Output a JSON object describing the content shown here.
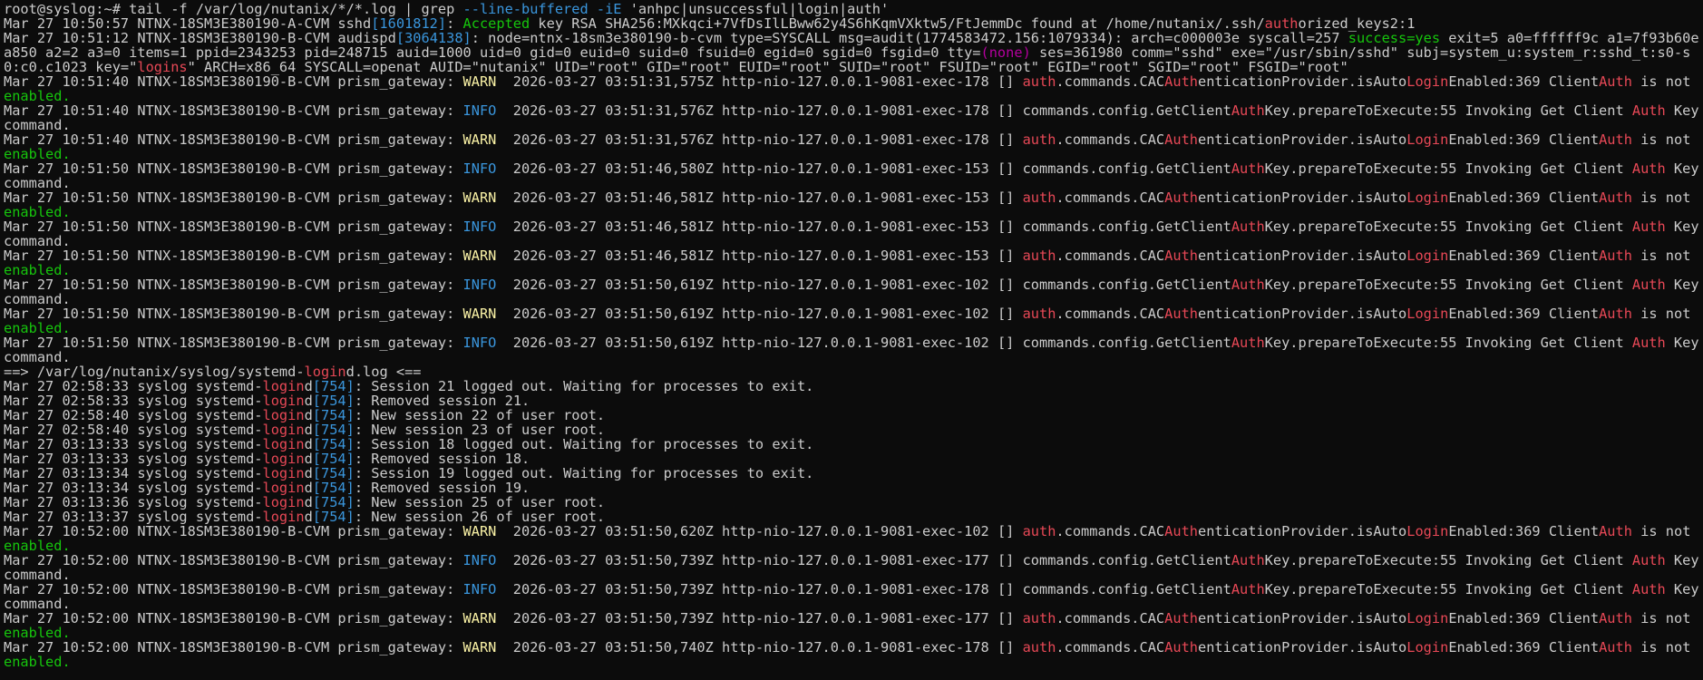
{
  "window": {
    "title": "root@syslog:~"
  },
  "colors": {
    "background": "#0c0c0c",
    "foreground": "#cccccc",
    "r": "#e74856",
    "g": "#16c60c",
    "b": "#3a96dd",
    "y": "#f9f1a5",
    "c": "#61d6d6",
    "m": "#b4009e"
  },
  "terminal": {
    "lines": [
      [
        {
          "t": "root@syslog:~# tail -f /var/log/nutanix/*/*.log | grep ",
          "c": "w"
        },
        {
          "t": "--line-buffered -iE",
          "c": "b"
        },
        {
          "t": " 'anhpc|unsuccessful|login|auth'",
          "c": "w"
        }
      ],
      [
        {
          "t": "Mar 27 10:50:57 NTNX-18SM3E380190-A-CVM sshd",
          "c": "w"
        },
        {
          "t": "[1601812]",
          "c": "b"
        },
        {
          "t": ": ",
          "c": "w"
        },
        {
          "t": "Accepted",
          "c": "g"
        },
        {
          "t": " key RSA SHA256:MXkqci+7VfDsIlLBww62y4S6hKqmVXktw5/FtJemmDc found at /home/nutanix/.ssh/",
          "c": "w"
        },
        {
          "t": "auth",
          "c": "r"
        },
        {
          "t": "orized_keys2:1",
          "c": "w"
        }
      ],
      [
        {
          "t": "Mar 27 10:51:12 NTNX-18SM3E380190-B-CVM audispd",
          "c": "w"
        },
        {
          "t": "[3064138]",
          "c": "b"
        },
        {
          "t": ": node=ntnx-18sm3e380190-b-cvm type=SYSCALL msg=audit(1774583472.156:1079334): arch=c000003e syscall=257 ",
          "c": "w"
        },
        {
          "t": "success=yes",
          "c": "g"
        },
        {
          "t": " exit=5 a0=ffffff9c a1=7f93b60ea850 a2=2 a3=0 items=1 ppid=2343253 pid=248715 auid=1000 uid=0 gid=0 euid=0 suid=0 fsuid=0 egid=0 sgid=0 fsgid=0 tty=",
          "c": "w"
        },
        {
          "t": "(none)",
          "c": "m"
        },
        {
          "t": " ses=361980 comm=\"sshd\" exe=\"/usr/sbin/sshd\" subj=system_u:system_r:sshd_t:s0-s0:c0.c1023 key=\"",
          "c": "w"
        },
        {
          "t": "logins",
          "c": "r"
        },
        {
          "t": "\" ARCH=x86_64 SYSCALL=openat AUID=\"nutanix\" UID=\"root\" GID=\"root\" EUID=\"root\" SUID=\"root\" FSUID=\"root\" EGID=\"root\" SGID=\"root\" FSGID=\"root\"",
          "c": "w"
        }
      ],
      [
        {
          "t": "Mar 27 10:51:40 NTNX-18SM3E380190-B-CVM prism_gateway: ",
          "c": "w"
        },
        {
          "t": "WARN",
          "c": "y"
        },
        {
          "t": "  2026-03-27 03:51:31,575Z http-nio-127.0.0.1-9081-exec-178 [] ",
          "c": "w"
        },
        {
          "t": "auth",
          "c": "r"
        },
        {
          "t": ".commands.CAC",
          "c": "w"
        },
        {
          "t": "Auth",
          "c": "r"
        },
        {
          "t": "enticationProvider.isAuto",
          "c": "w"
        },
        {
          "t": "Login",
          "c": "r"
        },
        {
          "t": "Enabled:369 Client",
          "c": "w"
        },
        {
          "t": "Auth",
          "c": "r"
        },
        {
          "t": " is not ",
          "c": "w"
        },
        {
          "t": "enabled.",
          "c": "g"
        }
      ],
      [
        {
          "t": "Mar 27 10:51:40 NTNX-18SM3E380190-B-CVM prism_gateway: ",
          "c": "w"
        },
        {
          "t": "INFO",
          "c": "b"
        },
        {
          "t": "  2026-03-27 03:51:31,576Z http-nio-127.0.0.1-9081-exec-178 [] commands.config.GetClient",
          "c": "w"
        },
        {
          "t": "Auth",
          "c": "r"
        },
        {
          "t": "Key.prepareToExecute:55 Invoking Get Client ",
          "c": "w"
        },
        {
          "t": "Auth",
          "c": "r"
        },
        {
          "t": " Key command.",
          "c": "w"
        }
      ],
      [
        {
          "t": "Mar 27 10:51:40 NTNX-18SM3E380190-B-CVM prism_gateway: ",
          "c": "w"
        },
        {
          "t": "WARN",
          "c": "y"
        },
        {
          "t": "  2026-03-27 03:51:31,576Z http-nio-127.0.0.1-9081-exec-178 [] ",
          "c": "w"
        },
        {
          "t": "auth",
          "c": "r"
        },
        {
          "t": ".commands.CAC",
          "c": "w"
        },
        {
          "t": "Auth",
          "c": "r"
        },
        {
          "t": "enticationProvider.isAuto",
          "c": "w"
        },
        {
          "t": "Login",
          "c": "r"
        },
        {
          "t": "Enabled:369 Client",
          "c": "w"
        },
        {
          "t": "Auth",
          "c": "r"
        },
        {
          "t": " is not ",
          "c": "w"
        },
        {
          "t": "enabled.",
          "c": "g"
        }
      ],
      [
        {
          "t": "Mar 27 10:51:50 NTNX-18SM3E380190-B-CVM prism_gateway: ",
          "c": "w"
        },
        {
          "t": "INFO",
          "c": "b"
        },
        {
          "t": "  2026-03-27 03:51:46,580Z http-nio-127.0.0.1-9081-exec-153 [] commands.config.GetClient",
          "c": "w"
        },
        {
          "t": "Auth",
          "c": "r"
        },
        {
          "t": "Key.prepareToExecute:55 Invoking Get Client ",
          "c": "w"
        },
        {
          "t": "Auth",
          "c": "r"
        },
        {
          "t": " Key command.",
          "c": "w"
        }
      ],
      [
        {
          "t": "Mar 27 10:51:50 NTNX-18SM3E380190-B-CVM prism_gateway: ",
          "c": "w"
        },
        {
          "t": "WARN",
          "c": "y"
        },
        {
          "t": "  2026-03-27 03:51:46,581Z http-nio-127.0.0.1-9081-exec-153 [] ",
          "c": "w"
        },
        {
          "t": "auth",
          "c": "r"
        },
        {
          "t": ".commands.CAC",
          "c": "w"
        },
        {
          "t": "Auth",
          "c": "r"
        },
        {
          "t": "enticationProvider.isAuto",
          "c": "w"
        },
        {
          "t": "Login",
          "c": "r"
        },
        {
          "t": "Enabled:369 Client",
          "c": "w"
        },
        {
          "t": "Auth",
          "c": "r"
        },
        {
          "t": " is not ",
          "c": "w"
        },
        {
          "t": "enabled.",
          "c": "g"
        }
      ],
      [
        {
          "t": "Mar 27 10:51:50 NTNX-18SM3E380190-B-CVM prism_gateway: ",
          "c": "w"
        },
        {
          "t": "INFO",
          "c": "b"
        },
        {
          "t": "  2026-03-27 03:51:46,581Z http-nio-127.0.0.1-9081-exec-153 [] commands.config.GetClient",
          "c": "w"
        },
        {
          "t": "Auth",
          "c": "r"
        },
        {
          "t": "Key.prepareToExecute:55 Invoking Get Client ",
          "c": "w"
        },
        {
          "t": "Auth",
          "c": "r"
        },
        {
          "t": " Key command.",
          "c": "w"
        }
      ],
      [
        {
          "t": "Mar 27 10:51:50 NTNX-18SM3E380190-B-CVM prism_gateway: ",
          "c": "w"
        },
        {
          "t": "WARN",
          "c": "y"
        },
        {
          "t": "  2026-03-27 03:51:46,581Z http-nio-127.0.0.1-9081-exec-153 [] ",
          "c": "w"
        },
        {
          "t": "auth",
          "c": "r"
        },
        {
          "t": ".commands.CAC",
          "c": "w"
        },
        {
          "t": "Auth",
          "c": "r"
        },
        {
          "t": "enticationProvider.isAuto",
          "c": "w"
        },
        {
          "t": "Login",
          "c": "r"
        },
        {
          "t": "Enabled:369 Client",
          "c": "w"
        },
        {
          "t": "Auth",
          "c": "r"
        },
        {
          "t": " is not ",
          "c": "w"
        },
        {
          "t": "enabled.",
          "c": "g"
        }
      ],
      [
        {
          "t": "Mar 27 10:51:50 NTNX-18SM3E380190-B-CVM prism_gateway: ",
          "c": "w"
        },
        {
          "t": "INFO",
          "c": "b"
        },
        {
          "t": "  2026-03-27 03:51:50,619Z http-nio-127.0.0.1-9081-exec-102 [] commands.config.GetClient",
          "c": "w"
        },
        {
          "t": "Auth",
          "c": "r"
        },
        {
          "t": "Key.prepareToExecute:55 Invoking Get Client ",
          "c": "w"
        },
        {
          "t": "Auth",
          "c": "r"
        },
        {
          "t": " Key command.",
          "c": "w"
        }
      ],
      [
        {
          "t": "Mar 27 10:51:50 NTNX-18SM3E380190-B-CVM prism_gateway: ",
          "c": "w"
        },
        {
          "t": "WARN",
          "c": "y"
        },
        {
          "t": "  2026-03-27 03:51:50,619Z http-nio-127.0.0.1-9081-exec-102 [] ",
          "c": "w"
        },
        {
          "t": "auth",
          "c": "r"
        },
        {
          "t": ".commands.CAC",
          "c": "w"
        },
        {
          "t": "Auth",
          "c": "r"
        },
        {
          "t": "enticationProvider.isAuto",
          "c": "w"
        },
        {
          "t": "Login",
          "c": "r"
        },
        {
          "t": "Enabled:369 Client",
          "c": "w"
        },
        {
          "t": "Auth",
          "c": "r"
        },
        {
          "t": " is not ",
          "c": "w"
        },
        {
          "t": "enabled.",
          "c": "g"
        }
      ],
      [
        {
          "t": "Mar 27 10:51:50 NTNX-18SM3E380190-B-CVM prism_gateway: ",
          "c": "w"
        },
        {
          "t": "INFO",
          "c": "b"
        },
        {
          "t": "  2026-03-27 03:51:50,619Z http-nio-127.0.0.1-9081-exec-102 [] commands.config.GetClient",
          "c": "w"
        },
        {
          "t": "Auth",
          "c": "r"
        },
        {
          "t": "Key.prepareToExecute:55 Invoking Get Client ",
          "c": "w"
        },
        {
          "t": "Auth",
          "c": "r"
        },
        {
          "t": " Key command.",
          "c": "w"
        }
      ],
      [
        {
          "t": "==> /var/log/nutanix/syslog/systemd-",
          "c": "w"
        },
        {
          "t": "login",
          "c": "r"
        },
        {
          "t": "d.log <==",
          "c": "w"
        }
      ],
      [
        {
          "t": "Mar 27 02:58:33 syslog systemd-",
          "c": "w"
        },
        {
          "t": "login",
          "c": "r"
        },
        {
          "t": "d",
          "c": "w"
        },
        {
          "t": "[754]",
          "c": "b"
        },
        {
          "t": ": Session 21 logged out. Waiting for processes to exit.",
          "c": "w"
        }
      ],
      [
        {
          "t": "Mar 27 02:58:33 syslog systemd-",
          "c": "w"
        },
        {
          "t": "login",
          "c": "r"
        },
        {
          "t": "d",
          "c": "w"
        },
        {
          "t": "[754]",
          "c": "b"
        },
        {
          "t": ": Removed session 21.",
          "c": "w"
        }
      ],
      [
        {
          "t": "Mar 27 02:58:40 syslog systemd-",
          "c": "w"
        },
        {
          "t": "login",
          "c": "r"
        },
        {
          "t": "d",
          "c": "w"
        },
        {
          "t": "[754]",
          "c": "b"
        },
        {
          "t": ": New session 22 of user root.",
          "c": "w"
        }
      ],
      [
        {
          "t": "Mar 27 02:58:40 syslog systemd-",
          "c": "w"
        },
        {
          "t": "login",
          "c": "r"
        },
        {
          "t": "d",
          "c": "w"
        },
        {
          "t": "[754]",
          "c": "b"
        },
        {
          "t": ": New session 23 of user root.",
          "c": "w"
        }
      ],
      [
        {
          "t": "Mar 27 03:13:33 syslog systemd-",
          "c": "w"
        },
        {
          "t": "login",
          "c": "r"
        },
        {
          "t": "d",
          "c": "w"
        },
        {
          "t": "[754]",
          "c": "b"
        },
        {
          "t": ": Session 18 logged out. Waiting for processes to exit.",
          "c": "w"
        }
      ],
      [
        {
          "t": "Mar 27 03:13:33 syslog systemd-",
          "c": "w"
        },
        {
          "t": "login",
          "c": "r"
        },
        {
          "t": "d",
          "c": "w"
        },
        {
          "t": "[754]",
          "c": "b"
        },
        {
          "t": ": Removed session 18.",
          "c": "w"
        }
      ],
      [
        {
          "t": "Mar 27 03:13:34 syslog systemd-",
          "c": "w"
        },
        {
          "t": "login",
          "c": "r"
        },
        {
          "t": "d",
          "c": "w"
        },
        {
          "t": "[754]",
          "c": "b"
        },
        {
          "t": ": Session 19 logged out. Waiting for processes to exit.",
          "c": "w"
        }
      ],
      [
        {
          "t": "Mar 27 03:13:34 syslog systemd-",
          "c": "w"
        },
        {
          "t": "login",
          "c": "r"
        },
        {
          "t": "d",
          "c": "w"
        },
        {
          "t": "[754]",
          "c": "b"
        },
        {
          "t": ": Removed session 19.",
          "c": "w"
        }
      ],
      [
        {
          "t": "Mar 27 03:13:36 syslog systemd-",
          "c": "w"
        },
        {
          "t": "login",
          "c": "r"
        },
        {
          "t": "d",
          "c": "w"
        },
        {
          "t": "[754]",
          "c": "b"
        },
        {
          "t": ": New session 25 of user root.",
          "c": "w"
        }
      ],
      [
        {
          "t": "Mar 27 03:13:37 syslog systemd-",
          "c": "w"
        },
        {
          "t": "login",
          "c": "r"
        },
        {
          "t": "d",
          "c": "w"
        },
        {
          "t": "[754]",
          "c": "b"
        },
        {
          "t": ": New session 26 of user root.",
          "c": "w"
        }
      ],
      [
        {
          "t": "Mar 27 10:52:00 NTNX-18SM3E380190-B-CVM prism_gateway: ",
          "c": "w"
        },
        {
          "t": "WARN",
          "c": "y"
        },
        {
          "t": "  2026-03-27 03:51:50,620Z http-nio-127.0.0.1-9081-exec-102 [] ",
          "c": "w"
        },
        {
          "t": "auth",
          "c": "r"
        },
        {
          "t": ".commands.CAC",
          "c": "w"
        },
        {
          "t": "Auth",
          "c": "r"
        },
        {
          "t": "enticationProvider.isAuto",
          "c": "w"
        },
        {
          "t": "Login",
          "c": "r"
        },
        {
          "t": "Enabled:369 Client",
          "c": "w"
        },
        {
          "t": "Auth",
          "c": "r"
        },
        {
          "t": " is not ",
          "c": "w"
        },
        {
          "t": "enabled.",
          "c": "g"
        }
      ],
      [
        {
          "t": "Mar 27 10:52:00 NTNX-18SM3E380190-B-CVM prism_gateway: ",
          "c": "w"
        },
        {
          "t": "INFO",
          "c": "b"
        },
        {
          "t": "  2026-03-27 03:51:50,739Z http-nio-127.0.0.1-9081-exec-177 [] commands.config.GetClient",
          "c": "w"
        },
        {
          "t": "Auth",
          "c": "r"
        },
        {
          "t": "Key.prepareToExecute:55 Invoking Get Client ",
          "c": "w"
        },
        {
          "t": "Auth",
          "c": "r"
        },
        {
          "t": " Key command.",
          "c": "w"
        }
      ],
      [
        {
          "t": "Mar 27 10:52:00 NTNX-18SM3E380190-B-CVM prism_gateway: ",
          "c": "w"
        },
        {
          "t": "INFO",
          "c": "b"
        },
        {
          "t": "  2026-03-27 03:51:50,739Z http-nio-127.0.0.1-9081-exec-178 [] commands.config.GetClient",
          "c": "w"
        },
        {
          "t": "Auth",
          "c": "r"
        },
        {
          "t": "Key.prepareToExecute:55 Invoking Get Client ",
          "c": "w"
        },
        {
          "t": "Auth",
          "c": "r"
        },
        {
          "t": " Key command.",
          "c": "w"
        }
      ],
      [
        {
          "t": "Mar 27 10:52:00 NTNX-18SM3E380190-B-CVM prism_gateway: ",
          "c": "w"
        },
        {
          "t": "WARN",
          "c": "y"
        },
        {
          "t": "  2026-03-27 03:51:50,739Z http-nio-127.0.0.1-9081-exec-177 [] ",
          "c": "w"
        },
        {
          "t": "auth",
          "c": "r"
        },
        {
          "t": ".commands.CAC",
          "c": "w"
        },
        {
          "t": "Auth",
          "c": "r"
        },
        {
          "t": "enticationProvider.isAuto",
          "c": "w"
        },
        {
          "t": "Login",
          "c": "r"
        },
        {
          "t": "Enabled:369 Client",
          "c": "w"
        },
        {
          "t": "Auth",
          "c": "r"
        },
        {
          "t": " is not ",
          "c": "w"
        },
        {
          "t": "enabled.",
          "c": "g"
        }
      ],
      [
        {
          "t": "Mar 27 10:52:00 NTNX-18SM3E380190-B-CVM prism_gateway: ",
          "c": "w"
        },
        {
          "t": "WARN",
          "c": "y"
        },
        {
          "t": "  2026-03-27 03:51:50,740Z http-nio-127.0.0.1-9081-exec-178 [] ",
          "c": "w"
        },
        {
          "t": "auth",
          "c": "r"
        },
        {
          "t": ".commands.CAC",
          "c": "w"
        },
        {
          "t": "Auth",
          "c": "r"
        },
        {
          "t": "enticationProvider.isAuto",
          "c": "w"
        },
        {
          "t": "Login",
          "c": "r"
        },
        {
          "t": "Enabled:369 Client",
          "c": "w"
        },
        {
          "t": "Auth",
          "c": "r"
        },
        {
          "t": " is not ",
          "c": "w"
        },
        {
          "t": "enabled.",
          "c": "g"
        }
      ]
    ]
  }
}
